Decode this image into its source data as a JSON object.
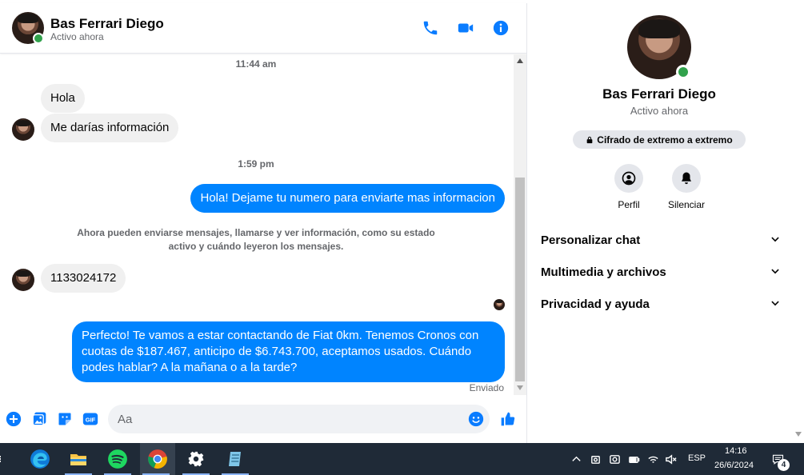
{
  "header": {
    "contact_name": "Bas Ferrari Diego",
    "status": "Activo ahora",
    "icons": [
      "phone-icon",
      "video-camera-icon",
      "info-icon"
    ]
  },
  "messages": {
    "timestamp_1": "11:44 am",
    "msg_hola": "Hola",
    "msg_informacion": "Me darías información",
    "timestamp_2": "1:59 pm",
    "msg_reply_1": "Hola! Dejame tu numero para enviarte mas informacion",
    "system_note": "Ahora pueden enviarse mensajes, llamarse y ver información, como su estado activo y cuándo leyeron los mensajes.",
    "msg_number": "1133024172",
    "msg_reply_2": "Perfecto! Te vamos a estar contactando de Fiat 0km. Tenemos Cronos con cuotas de $187.467, anticipo de $6.743.700, aceptamos usados. Cuándo podes hablar? A la mañana o a la tarde?",
    "sent_status": "Enviado"
  },
  "composer": {
    "placeholder": "Aa",
    "icons": [
      "plus-icon",
      "image-icon",
      "sticker-icon",
      "gif-icon",
      "emoji-icon",
      "like-icon"
    ]
  },
  "info_panel": {
    "name": "Bas Ferrari Diego",
    "status": "Activo ahora",
    "e2e_label": "Cifrado de extremo a extremo",
    "actions": {
      "profile": "Perfil",
      "mute": "Silenciar"
    },
    "sections": {
      "customize": "Personalizar chat",
      "media": "Multimedia y archivos",
      "privacy": "Privacidad y ayuda"
    }
  },
  "taskbar": {
    "language": "ESP",
    "time": "14:16",
    "date": "26/6/2024",
    "notification_count": "4",
    "apps": [
      "edge-icon",
      "file-explorer-icon",
      "spotify-icon",
      "chrome-icon",
      "settings-icon",
      "notepad-icon"
    ]
  },
  "colors": {
    "accent": "#0084ff",
    "icon_blue": "#0a7cff",
    "online": "#31a24c",
    "incoming_bubble": "#f0f0f0",
    "taskbar": "#1f2a37"
  }
}
